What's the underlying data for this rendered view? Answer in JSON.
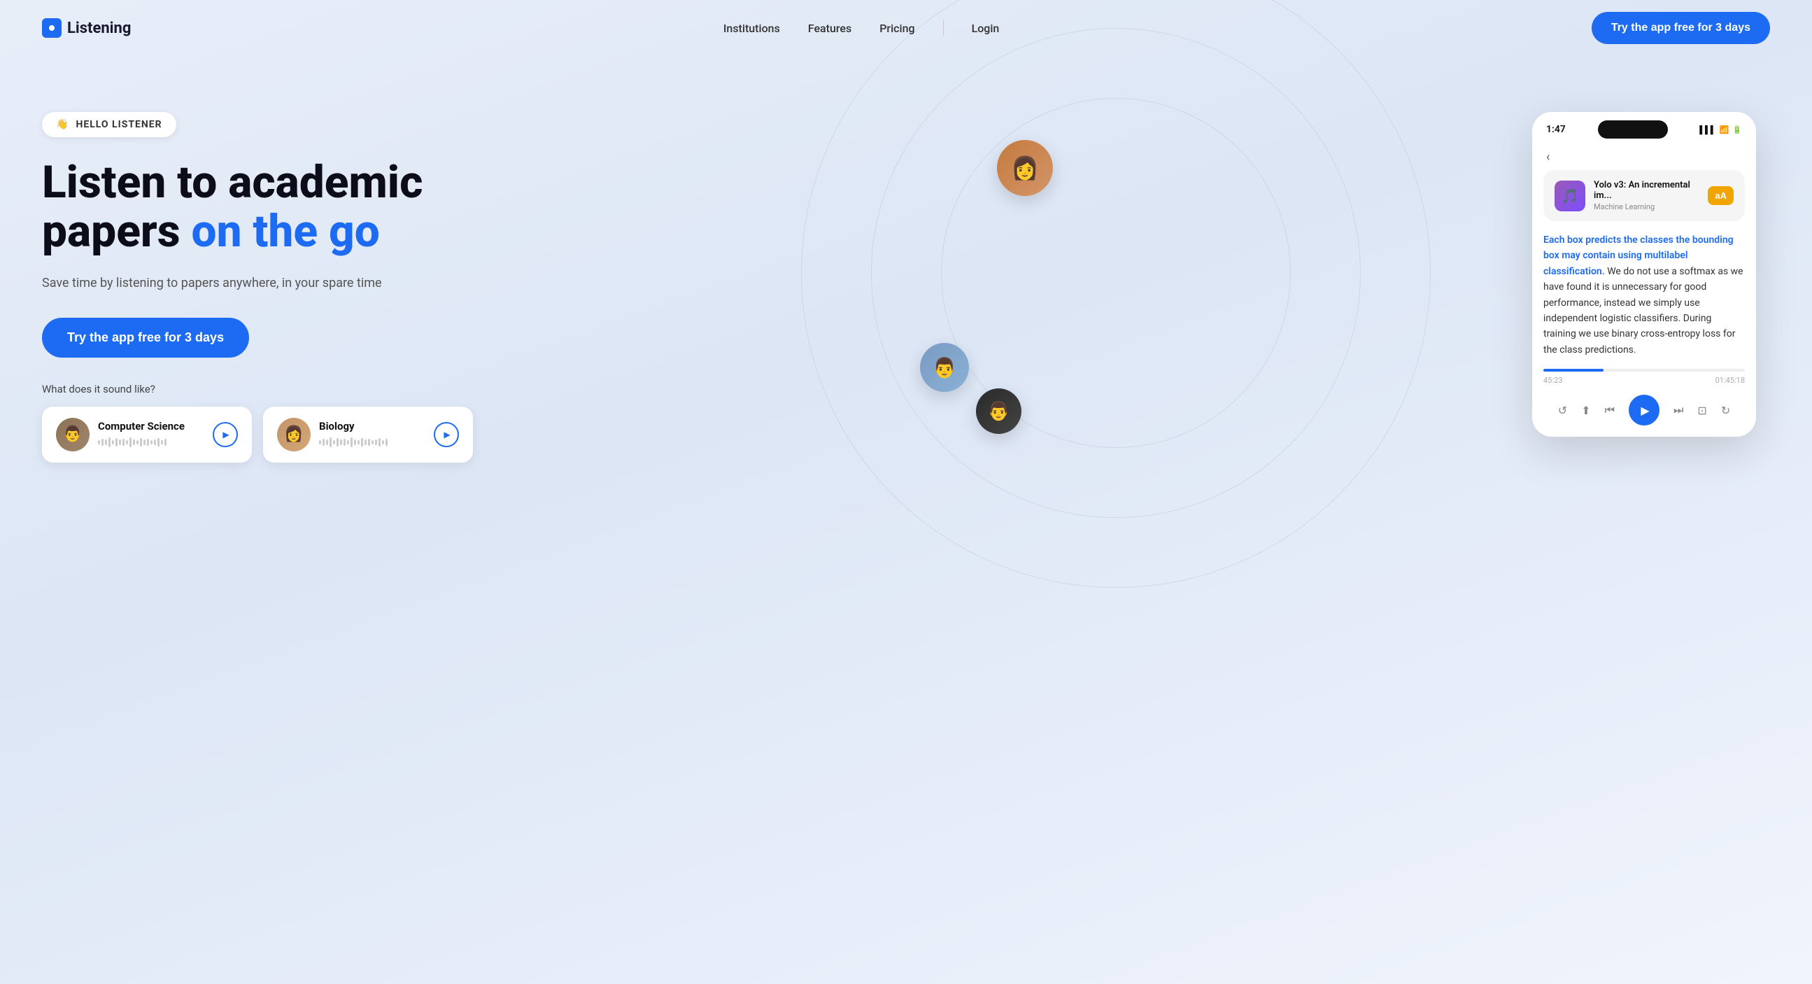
{
  "nav": {
    "logo_text": "Listening",
    "links": [
      {
        "label": "Institutions",
        "id": "institutions"
      },
      {
        "label": "Features",
        "id": "features"
      },
      {
        "label": "Pricing",
        "id": "pricing"
      },
      {
        "label": "Login",
        "id": "login"
      }
    ],
    "cta_label": "Try the app free for 3 days"
  },
  "hero": {
    "badge_emoji": "👋",
    "badge_text": "HELLO LISTENER",
    "title_part1": "Listen to academic",
    "title_part2": "papers ",
    "title_highlight": "on the go",
    "subtitle": "Save time by listening to papers anywhere, in your spare time",
    "cta_label": "Try the app free for 3 days",
    "sound_label": "What does it sound like?",
    "audio_cards": [
      {
        "id": "cs",
        "avatar_emoji": "👨",
        "title": "Computer Science"
      },
      {
        "id": "bio",
        "avatar_emoji": "👩",
        "title": "Biology"
      }
    ]
  },
  "phone": {
    "time": "1:47",
    "back_icon": "‹",
    "paper_icon_emoji": "🎵",
    "paper_title": "Yolo v3: An incremental im...",
    "paper_category": "Machine Learning",
    "aa_label": "aA",
    "content_blue": "Each box predicts the classes the bounding box may contain using multilabel classification.",
    "content_body": " We do not use a softmax as we have found it is unnecessary for good performance, instead we simply use independent logistic classifiers. During training we use binary cross-entropy loss for the class predictions.",
    "progress_time_current": "45:23",
    "progress_time_total": "01:45:18"
  },
  "floating_avatars": [
    {
      "emoji": "👩",
      "id": "avatar-top"
    },
    {
      "emoji": "👨",
      "id": "avatar-mid"
    },
    {
      "emoji": "👨",
      "id": "avatar-bot"
    }
  ]
}
